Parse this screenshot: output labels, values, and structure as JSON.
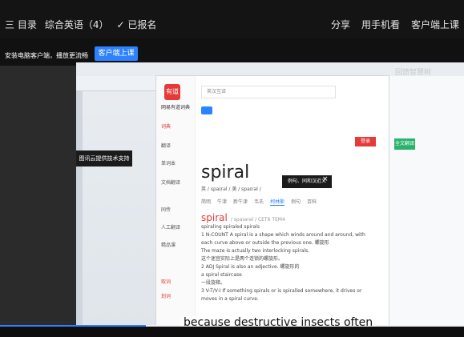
{
  "topbar": {
    "left": [
      "三 目录",
      "综合英语（4）",
      "✓ 已报名"
    ],
    "right": [
      "分享",
      "用手机看",
      "客户端上课"
    ]
  },
  "banner": {
    "text": "安装电脑客户端，播放更流畅",
    "button": "客户端上课"
  },
  "dict": {
    "logo": "有道",
    "brand": "网易有道词典",
    "search_text": "英汉互译",
    "nav": [
      "词典",
      "翻译",
      "单词本",
      "文档翻译",
      "同传",
      "人工翻译",
      "精品课"
    ],
    "nav_bottom": [
      "取词",
      "划词"
    ],
    "word": "spiral",
    "tooltip": "图讯云提供技术支持",
    "tooltip2": "例句、同和汉近义",
    "phonetic": "英 / spaɪrəl /   美 / spaɪrəl /",
    "tabs": [
      "简明",
      "牛津",
      "新牛津",
      "韦氏",
      "柯林斯",
      "例句",
      "百科"
    ],
    "collins_word": "spiral",
    "collins_phon": "/ spaɪərəl /   CET6 TEM4",
    "collins_forms": "spiraling spiraled spirals",
    "defs": [
      "1  N-COUNT A spiral is a shape which winds around and around, with each curve above or outside the previous one. 螺旋形",
      "The maze is actually two interlocking spirals.",
      "这个迷宫实际上是两个连锁的螺旋形。",
      "2  ADJ Spiral is also an adjective. 螺旋形的",
      "a spiral staircase",
      "一段旋梯。",
      "3  V-T/V-I If something spirals or is spiralled somewhere, it drives or moves in a spiral curve."
    ],
    "red_button": "登录"
  },
  "right_panel_tag": "全文翻译",
  "subtitle": "because destructive insects often",
  "watermark": "回馈智慧树"
}
